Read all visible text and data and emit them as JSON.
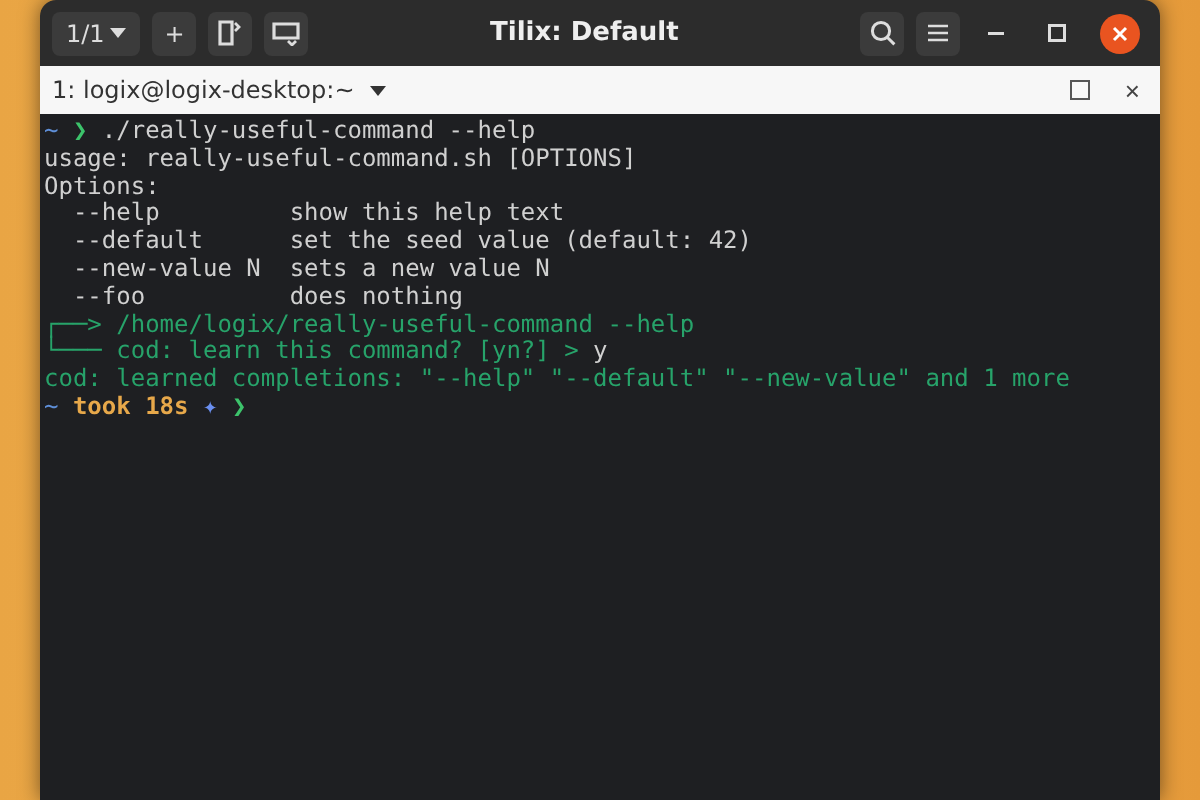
{
  "window": {
    "title": "Tilix: Default",
    "session_switcher": "1/1",
    "new_session_button": "+"
  },
  "tab": {
    "title": "1: logix@logix-desktop:~",
    "close": "×"
  },
  "terminal": {
    "lines": [
      [
        {
          "text": "~ ",
          "kind": "directory"
        },
        {
          "text": "❯ ",
          "kind": "prompt"
        },
        {
          "text": "./really-useful-command --help",
          "kind": "output"
        }
      ],
      [
        {
          "text": "usage: really-useful-command.sh [OPTIONS]",
          "kind": "output"
        }
      ],
      [
        {
          "text": "Options:",
          "kind": "output"
        }
      ],
      [
        {
          "text": "  --help         show this help text",
          "kind": "output"
        }
      ],
      [
        {
          "text": "  --default      set the seed value (default: 42)",
          "kind": "output"
        }
      ],
      [
        {
          "text": "  --new-value N  sets a new value N",
          "kind": "output"
        }
      ],
      [
        {
          "text": "  --foo          does nothing",
          "kind": "output"
        }
      ],
      [
        {
          "text": "┌──> /home/logix/really-useful-command --help",
          "kind": "message"
        }
      ],
      [
        {
          "text": "└─── cod: learn this command? [yn?] > ",
          "kind": "message"
        },
        {
          "text": "y",
          "kind": "output"
        }
      ],
      [
        {
          "text": "cod: learned completions: \"--help\" \"--default\" \"--new-value\" and 1 more",
          "kind": "message"
        }
      ],
      [
        {
          "text": "~ ",
          "kind": "directory"
        },
        {
          "text": "took 18s ",
          "kind": "duration"
        },
        {
          "text": "✦ ",
          "kind": "symbol"
        },
        {
          "text": "❯",
          "kind": "prompt"
        }
      ]
    ]
  }
}
